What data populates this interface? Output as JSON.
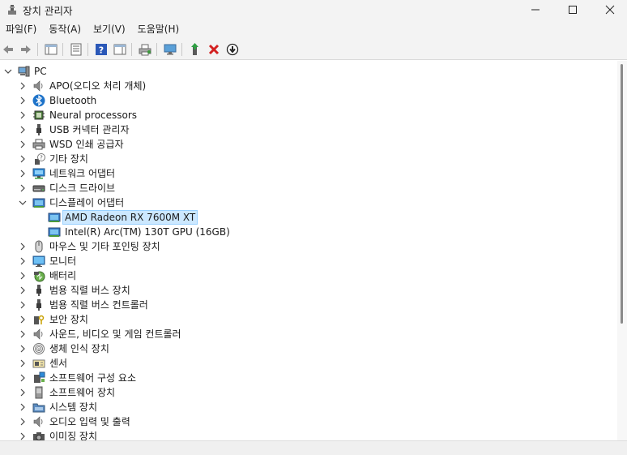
{
  "window": {
    "title": "장치 관리자"
  },
  "menu": [
    "파일(F)",
    "동작(A)",
    "보기(V)",
    "도움말(H)"
  ],
  "tree": {
    "root": "PC",
    "categories": [
      {
        "label": "APO(오디오 처리 개체)",
        "icon": "speaker-icon"
      },
      {
        "label": "Bluetooth",
        "icon": "bluetooth-icon"
      },
      {
        "label": "Neural processors",
        "icon": "processor-icon"
      },
      {
        "label": "USB 커넥터 관리자",
        "icon": "usb-icon"
      },
      {
        "label": "WSD 인쇄 공급자",
        "icon": "printer-icon"
      },
      {
        "label": "기타 장치",
        "icon": "unknown-device-icon"
      },
      {
        "label": "네트워크 어댑터",
        "icon": "network-icon"
      },
      {
        "label": "디스크 드라이브",
        "icon": "disk-icon"
      },
      {
        "label": "디스플레이 어댑터",
        "icon": "display-adapter-icon",
        "expanded": true,
        "children": [
          {
            "label": "AMD Radeon RX 7600M XT",
            "icon": "display-adapter-icon",
            "selected": true
          },
          {
            "label": "Intel(R) Arc(TM) 130T GPU (16GB)",
            "icon": "display-adapter-icon"
          }
        ]
      },
      {
        "label": "마우스 및 기타 포인팅 장치",
        "icon": "mouse-icon"
      },
      {
        "label": "모니터",
        "icon": "monitor-icon"
      },
      {
        "label": "배터리",
        "icon": "battery-icon"
      },
      {
        "label": "범용 직렬 버스 장치",
        "icon": "usb-icon"
      },
      {
        "label": "범용 직렬 버스 컨트롤러",
        "icon": "usb-icon"
      },
      {
        "label": "보안 장치",
        "icon": "security-key-icon"
      },
      {
        "label": "사운드, 비디오 및 게임 컨트롤러",
        "icon": "speaker-icon"
      },
      {
        "label": "생체 인식 장치",
        "icon": "fingerprint-icon"
      },
      {
        "label": "센서",
        "icon": "sensor-icon"
      },
      {
        "label": "소프트웨어 구성 요소",
        "icon": "software-component-icon"
      },
      {
        "label": "소프트웨어 장치",
        "icon": "software-device-icon"
      },
      {
        "label": "시스템 장치",
        "icon": "system-folder-icon"
      },
      {
        "label": "오디오 입력 및 출력",
        "icon": "speaker-icon"
      },
      {
        "label": "이미징 장치",
        "icon": "camera-icon"
      }
    ]
  },
  "colors": {
    "selection_bg": "#cce8ff",
    "selection_border": "#99d1ff",
    "accent_blue": "#1e73c9"
  }
}
